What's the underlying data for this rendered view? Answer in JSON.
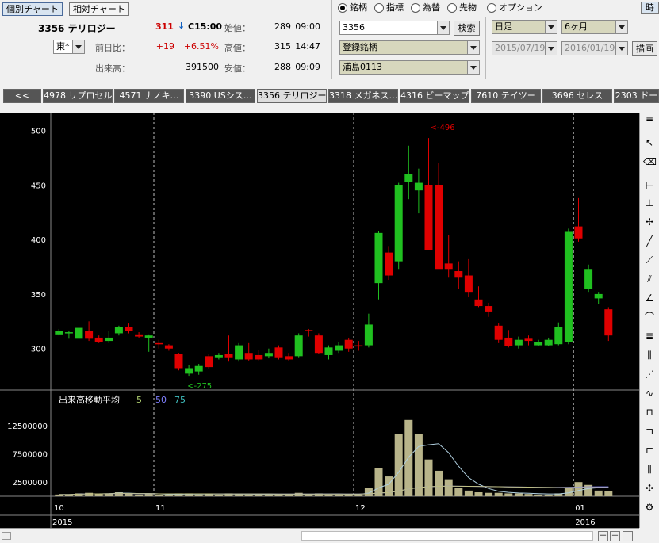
{
  "tabs": {
    "individual": "個別チャート",
    "relative": "相対チャート"
  },
  "stock": {
    "code_name": "3356 テリロジー",
    "price": "311",
    "arrow": "↓",
    "close_time": "C15:00",
    "market": "東*",
    "prev_label": "前日比：",
    "change": "+19",
    "change_pct": "+6.51%",
    "volume_label": "出来高：",
    "volume": "391500",
    "open_label": "始値：",
    "open": "289",
    "open_time": "09:00",
    "high_label": "高値：",
    "high": "315",
    "high_time": "14:47",
    "low_label": "安値：",
    "low": "288",
    "low_time": "09:09"
  },
  "radios": [
    "銘柄",
    "指標",
    "為替",
    "先物",
    "オプション"
  ],
  "search": {
    "code": "3356",
    "button": "検索",
    "list1": "登録銘柄",
    "list2": "浦島0113"
  },
  "period": {
    "interval": "日足",
    "range": "6ヶ月",
    "from": "2015/07/19",
    "to": "2016/01/19",
    "draw": "描画"
  },
  "corner_button": "時",
  "stock_tabs": [
    "<<",
    "4978 リプロセル",
    "4571 ナノキ…",
    "3390 USシス…",
    "3356 テリロジー",
    "3318 メガネス…",
    "4316 ビーマップ",
    "7610 テイツー",
    "3696 セレス",
    "2303 ドー"
  ],
  "chart_data": {
    "type": "candlestick",
    "price_axis": {
      "ticks": [
        300,
        350,
        400,
        450,
        500
      ],
      "range": [
        262,
        512
      ]
    },
    "volume_axis": {
      "ticks": [
        2500000,
        7500000,
        12500000
      ],
      "tick_labels": [
        "2500000",
        "7500000",
        "12500000"
      ],
      "range": [
        0,
        16000000
      ]
    },
    "volume_title": "出来高移動平均",
    "ma_labels": [
      "5",
      "50",
      "75"
    ],
    "min_label": "<-275",
    "max_label": "<-496",
    "month_labels": [
      "10",
      "11",
      "12",
      "01"
    ],
    "year_labels": [
      "2015",
      "2016"
    ],
    "candles": [
      {
        "o": 313,
        "c": 316,
        "h": 318,
        "l": 312,
        "v": 300000
      },
      {
        "o": 314,
        "c": 315,
        "h": 316,
        "l": 309,
        "v": 300000
      },
      {
        "o": 309,
        "c": 319,
        "h": 320,
        "l": 308,
        "v": 500000
      },
      {
        "o": 316,
        "c": 309,
        "h": 325,
        "l": 307,
        "v": 600000
      },
      {
        "o": 310,
        "c": 306,
        "h": 312,
        "l": 305,
        "v": 400000
      },
      {
        "o": 307,
        "c": 310,
        "h": 316,
        "l": 305,
        "v": 500000
      },
      {
        "o": 314,
        "c": 320,
        "h": 321,
        "l": 312,
        "v": 700000
      },
      {
        "o": 320,
        "c": 316,
        "h": 323,
        "l": 314,
        "v": 500000
      },
      {
        "o": 313,
        "c": 311,
        "h": 315,
        "l": 310,
        "v": 300000
      },
      {
        "o": 310,
        "c": 312,
        "h": 313,
        "l": 297,
        "v": 400000
      },
      {
        "o": 305,
        "c": 304,
        "h": 308,
        "l": 300,
        "v": 200000
      },
      {
        "o": 303,
        "c": 300,
        "h": 304,
        "l": 298,
        "v": 300000
      },
      {
        "o": 295,
        "c": 282,
        "h": 296,
        "l": 280,
        "v": 500000
      },
      {
        "o": 277,
        "c": 282,
        "h": 285,
        "l": 275,
        "v": 500000
      },
      {
        "o": 279,
        "c": 284,
        "h": 286,
        "l": 276,
        "v": 300000
      },
      {
        "o": 293,
        "c": 283,
        "h": 295,
        "l": 281,
        "v": 400000
      },
      {
        "o": 292,
        "c": 294,
        "h": 296,
        "l": 290,
        "v": 200000
      },
      {
        "o": 295,
        "c": 292,
        "h": 312,
        "l": 288,
        "v": 500000
      },
      {
        "o": 290,
        "c": 303,
        "h": 305,
        "l": 288,
        "v": 400000
      },
      {
        "o": 296,
        "c": 290,
        "h": 305,
        "l": 289,
        "v": 300000
      },
      {
        "o": 294,
        "c": 290,
        "h": 299,
        "l": 289,
        "v": 300000
      },
      {
        "o": 293,
        "c": 296,
        "h": 300,
        "l": 291,
        "v": 300000
      },
      {
        "o": 301,
        "c": 292,
        "h": 303,
        "l": 290,
        "v": 300000
      },
      {
        "o": 293,
        "c": 290,
        "h": 296,
        "l": 289,
        "v": 200000
      },
      {
        "o": 293,
        "c": 312,
        "h": 314,
        "l": 292,
        "v": 600000
      },
      {
        "o": 317,
        "c": 316,
        "h": 318,
        "l": 311,
        "v": 300000
      },
      {
        "o": 312,
        "c": 296,
        "h": 314,
        "l": 295,
        "v": 500000
      },
      {
        "o": 294,
        "c": 301,
        "h": 303,
        "l": 290,
        "v": 300000
      },
      {
        "o": 298,
        "c": 303,
        "h": 306,
        "l": 296,
        "v": 300000
      },
      {
        "o": 308,
        "c": 300,
        "h": 310,
        "l": 297,
        "v": 300000
      },
      {
        "o": 303,
        "c": 302,
        "h": 307,
        "l": 298,
        "v": 300000
      },
      {
        "o": 303,
        "c": 322,
        "h": 332,
        "l": 301,
        "v": 1500000
      },
      {
        "o": 360,
        "c": 406,
        "h": 408,
        "l": 345,
        "v": 5000000
      },
      {
        "o": 388,
        "c": 367,
        "h": 394,
        "l": 363,
        "v": 3500000
      },
      {
        "o": 380,
        "c": 450,
        "h": 452,
        "l": 373,
        "v": 11000000
      },
      {
        "o": 453,
        "c": 460,
        "h": 486,
        "l": 437,
        "v": 13500000
      },
      {
        "o": 445,
        "c": 452,
        "h": 465,
        "l": 424,
        "v": 11000000
      },
      {
        "o": 450,
        "c": 390,
        "h": 493,
        "l": 430,
        "v": 6500000
      },
      {
        "o": 450,
        "c": 373,
        "h": 470,
        "l": 375,
        "v": 4500000
      },
      {
        "o": 378,
        "c": 373,
        "h": 404,
        "l": 365,
        "v": 3000000
      },
      {
        "o": 371,
        "c": 365,
        "h": 380,
        "l": 355,
        "v": 1500000
      },
      {
        "o": 367,
        "c": 352,
        "h": 382,
        "l": 347,
        "v": 1000000
      },
      {
        "o": 345,
        "c": 339,
        "h": 357,
        "l": 338,
        "v": 700000
      },
      {
        "o": 339,
        "c": 334,
        "h": 342,
        "l": 329,
        "v": 600000
      },
      {
        "o": 321,
        "c": 308,
        "h": 323,
        "l": 305,
        "v": 600000
      },
      {
        "o": 310,
        "c": 302,
        "h": 317,
        "l": 301,
        "v": 500000
      },
      {
        "o": 303,
        "c": 308,
        "h": 311,
        "l": 300,
        "v": 500000
      },
      {
        "o": 309,
        "c": 307,
        "h": 312,
        "l": 303,
        "v": 400000
      },
      {
        "o": 303,
        "c": 306,
        "h": 308,
        "l": 302,
        "v": 300000
      },
      {
        "o": 303,
        "c": 308,
        "h": 310,
        "l": 302,
        "v": 300000
      },
      {
        "o": 304,
        "c": 320,
        "h": 324,
        "l": 303,
        "v": 500000
      },
      {
        "o": 306,
        "c": 407,
        "h": 410,
        "l": 304,
        "v": 1500000
      },
      {
        "o": 412,
        "c": 401,
        "h": 438,
        "l": 398,
        "v": 2500000
      },
      {
        "o": 355,
        "c": 373,
        "h": 377,
        "l": 352,
        "v": 2000000
      },
      {
        "o": 346,
        "c": 350,
        "h": 352,
        "l": 341,
        "v": 1000000
      },
      {
        "o": 336,
        "c": 312,
        "h": 338,
        "l": 307,
        "v": 900000
      }
    ]
  }
}
